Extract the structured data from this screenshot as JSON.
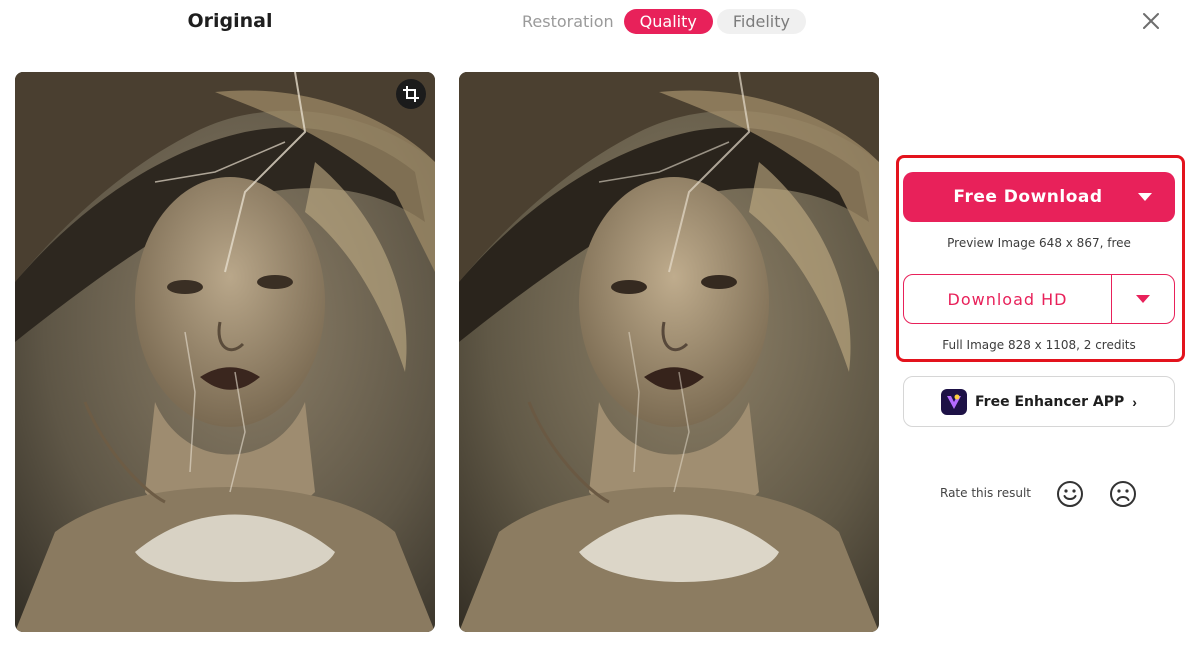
{
  "header": {
    "title": "Original",
    "tabs": [
      {
        "label": "Restoration",
        "state": "plain"
      },
      {
        "label": "Quality",
        "state": "active"
      },
      {
        "label": "Fidelity",
        "state": "inactive"
      }
    ],
    "close_icon": "close-icon"
  },
  "images": {
    "left": "original-photo",
    "right": "enhanced-photo",
    "crop_icon": "crop-icon"
  },
  "download": {
    "free_label": "Free Download",
    "free_note": "Preview Image 648 x 867, free",
    "hd_label": "Download HD",
    "hd_note": "Full Image 828 x 1108, 2 credits"
  },
  "app": {
    "label": "Free Enhancer APP",
    "chevron": "›"
  },
  "rating": {
    "label": "Rate this result",
    "icons": [
      "happy-face-icon",
      "sad-face-icon"
    ]
  },
  "colors": {
    "accent": "#e8215a",
    "highlight": "#e3131d"
  }
}
